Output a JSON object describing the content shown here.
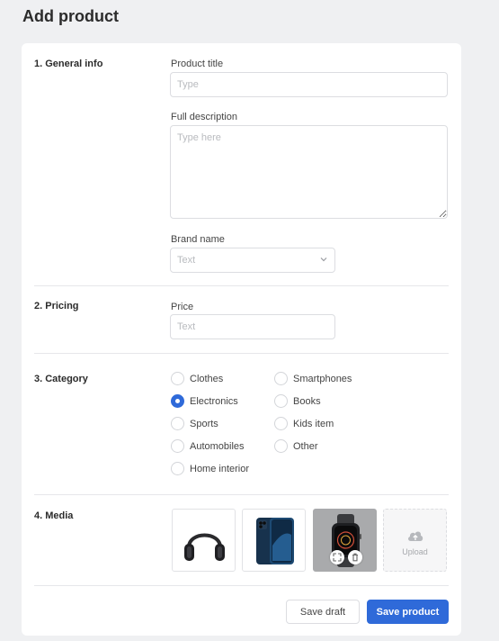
{
  "page": {
    "title": "Add product"
  },
  "general_info": {
    "section_title": "1. General info",
    "product_title": {
      "label": "Product title",
      "placeholder": "Type",
      "value": ""
    },
    "full_description": {
      "label": "Full description",
      "placeholder": "Type here",
      "value": ""
    },
    "brand_name": {
      "label": "Brand name",
      "selected": "Text"
    }
  },
  "pricing": {
    "section_title": "2. Pricing",
    "price": {
      "label": "Price",
      "placeholder": "Text",
      "value": ""
    }
  },
  "category": {
    "section_title": "3. Category",
    "options": [
      {
        "label": "Clothes",
        "checked": false
      },
      {
        "label": "Electronics",
        "checked": true
      },
      {
        "label": "Sports",
        "checked": false
      },
      {
        "label": "Automobiles",
        "checked": false
      },
      {
        "label": "Home interior",
        "checked": false
      },
      {
        "label": "Smartphones",
        "checked": false
      },
      {
        "label": "Books",
        "checked": false
      },
      {
        "label": "Kids item",
        "checked": false
      },
      {
        "label": "Other",
        "checked": false
      }
    ]
  },
  "media": {
    "section_title": "4. Media",
    "images": [
      {
        "icon": "headphones-image"
      },
      {
        "icon": "smartphone-image"
      },
      {
        "icon": "smartwatch-image",
        "selected": true
      }
    ],
    "upload_label": "Upload"
  },
  "actions": {
    "save_draft": "Save draft",
    "save_product": "Save product"
  },
  "colors": {
    "primary": "#2f6ad9",
    "background": "#eff0f2"
  }
}
